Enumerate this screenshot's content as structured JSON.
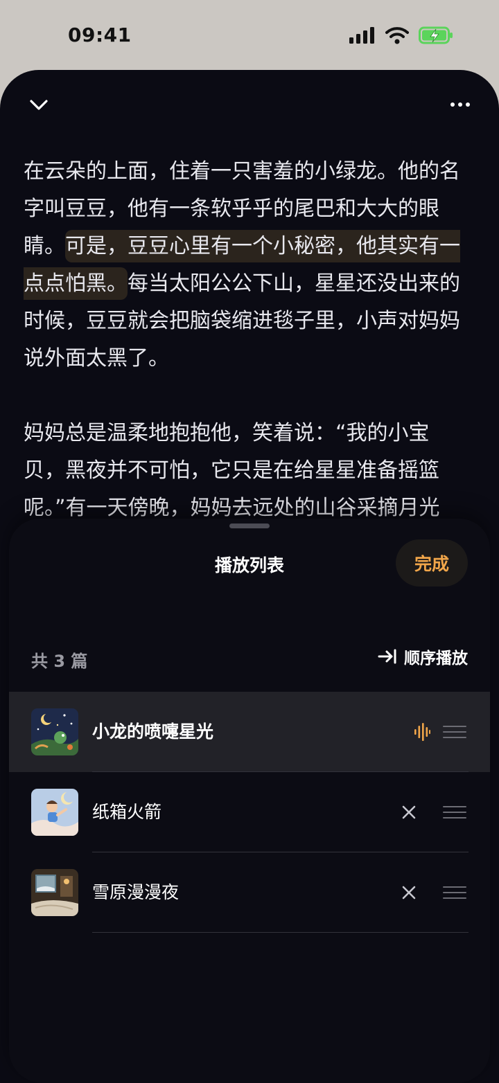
{
  "status_bar": {
    "time": "09:41"
  },
  "reader": {
    "paragraphs": [
      {
        "before": "在云朵的上面，住着一只害羞的小绿龙。他的名字叫豆豆，他有一条软乎乎的尾巴和大大的眼睛。",
        "highlight": "可是，豆豆心里有一个小秘密，他其实有一点点怕黑。",
        "after": "每当太阳公公下山，星星还没出来的时候，豆豆就会把脑袋缩进毯子里，小声对妈妈说外面太黑了。"
      },
      {
        "before": "妈妈总是温柔地抱抱他，笑着说：“我的小宝贝，黑夜并不可怕，它只是在给星星准备摇篮呢。”有一天傍晚，妈妈去远处的山谷采摘月光",
        "highlight": "",
        "after": ""
      }
    ]
  },
  "playlist": {
    "title": "播放列表",
    "done_label": "完成",
    "count_label": "共 3 篇",
    "order_label": "顺序播放",
    "items": [
      {
        "title": "小龙的喷嚏星光",
        "playing": true
      },
      {
        "title": "纸箱火箭",
        "playing": false
      },
      {
        "title": "雪原漫漫夜",
        "playing": false
      }
    ]
  },
  "colors": {
    "accent": "#f1a64a",
    "background": "#0b0b14",
    "highlight": "#2b241d",
    "battery": "#5bd45b"
  }
}
